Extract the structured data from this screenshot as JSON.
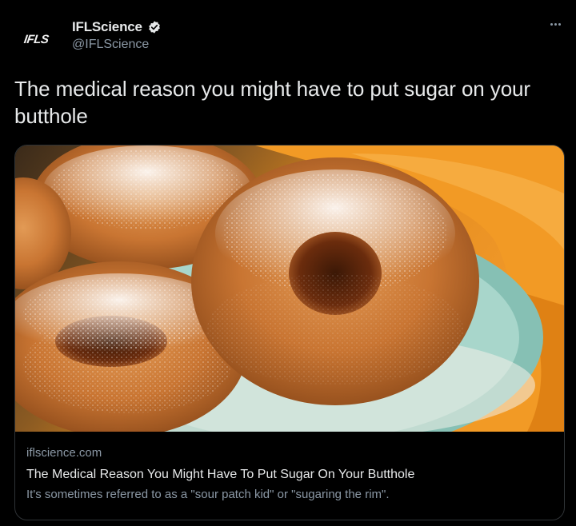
{
  "author": {
    "avatar_text": "IFLS",
    "display_name": "IFLScience",
    "handle": "@IFLScience",
    "verified": true
  },
  "tweet": {
    "text": "The medical reason you might have to put sugar on your butthole"
  },
  "card": {
    "image_icon": "powdered-donuts-photo",
    "domain": "iflscience.com",
    "title": "The Medical Reason You Might Have To Put Sugar On Your Butthole",
    "description": "It's sometimes referred to as a \"sour patch kid\" or \"sugaring the rim\"."
  },
  "colors": {
    "background": "#000000",
    "text_primary": "#e7e9ea",
    "text_secondary": "#8b98a5",
    "verified_badge": "#e7e9ea",
    "card_border": "#2f3336"
  }
}
